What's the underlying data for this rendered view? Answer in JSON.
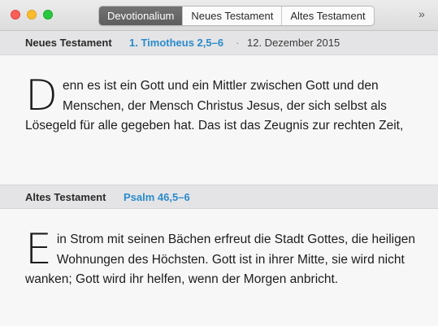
{
  "window": {
    "controls": {
      "close": "close-button",
      "minimize": "minimize-button",
      "zoom": "zoom-button"
    }
  },
  "tabs": [
    {
      "label": "Devotionalium",
      "active": true
    },
    {
      "label": "Neues Testament",
      "active": false
    },
    {
      "label": "Altes Testament",
      "active": false
    }
  ],
  "overflow_label": "»",
  "new_testament": {
    "book_label": "Neues Testament",
    "reference": "1. Timotheus 2,5–6",
    "separator": "·",
    "date": "12. Dezember 2015",
    "dropcap": "D",
    "text": "enn es ist ein Gott und ein Mittler zwischen Gott und den Menschen, der Mensch Christus Jesus, der sich selbst als Lösegeld für alle gegeben hat. Das ist das Zeugnis zur rechten Zeit,"
  },
  "old_testament": {
    "book_label": "Altes Testament",
    "reference": "Psalm 46,5–6",
    "dropcap": "E",
    "text": "in Strom mit seinen Bächen erfreut die Stadt Gottes, die heiligen Wohnungen des Höchsten. Gott ist in ihrer Mitte, sie wird nicht wanken; Gott wird ihr helfen, wenn der Morgen anbricht."
  },
  "colors": {
    "reference_link": "#2a8bcb",
    "active_tab": "#666666",
    "header_band": "#e4e4e6",
    "background": "#f7f7f8"
  }
}
